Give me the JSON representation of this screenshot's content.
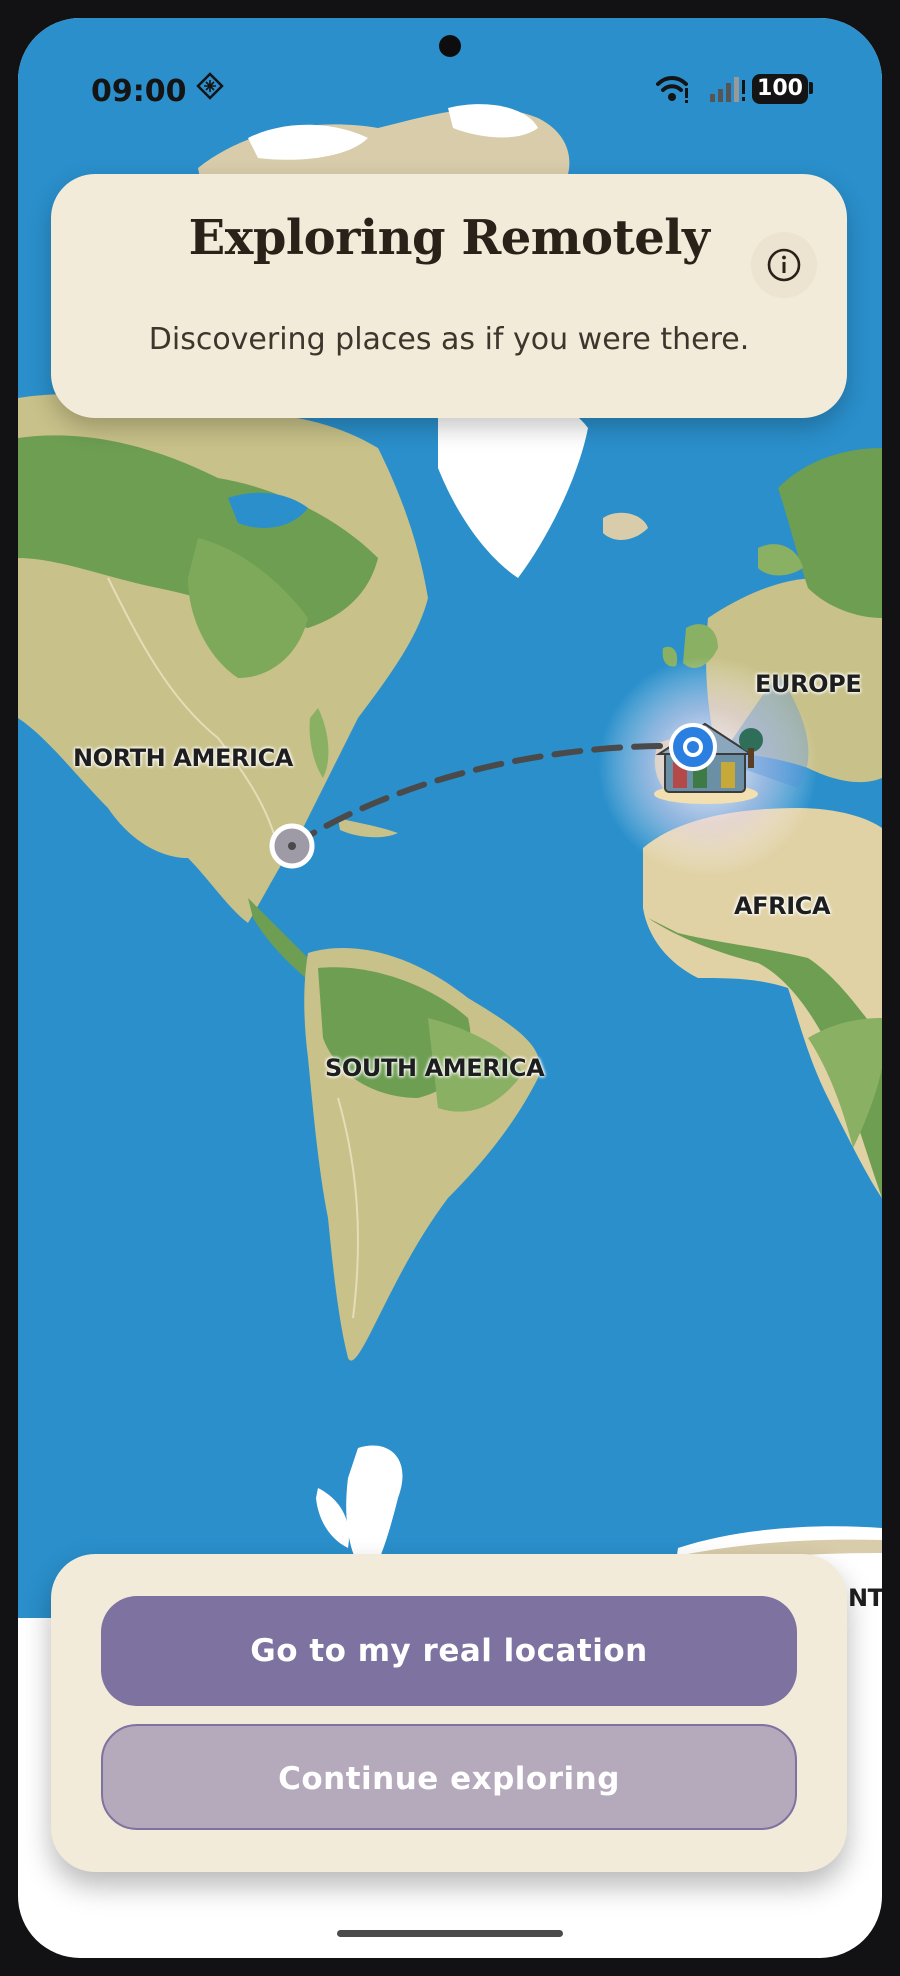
{
  "status_bar": {
    "time": "09:00",
    "battery": "100"
  },
  "header": {
    "title": "Exploring Remotely",
    "subtitle": "Discovering places as if you were there."
  },
  "map": {
    "labels": {
      "north_america": "NORTH AMERICA",
      "south_america": "SOUTH AMERICA",
      "europe": "EUROPE",
      "africa": "AFRICA",
      "antarctica_partial": "NTA"
    }
  },
  "actions": {
    "primary_label": "Go to my real location",
    "secondary_label": "Continue exploring"
  },
  "colors": {
    "ocean": "#2a8fcb",
    "card": "#f3ebd9",
    "primary_button": "#7e72a0",
    "secondary_button": "#b5a9bc"
  }
}
